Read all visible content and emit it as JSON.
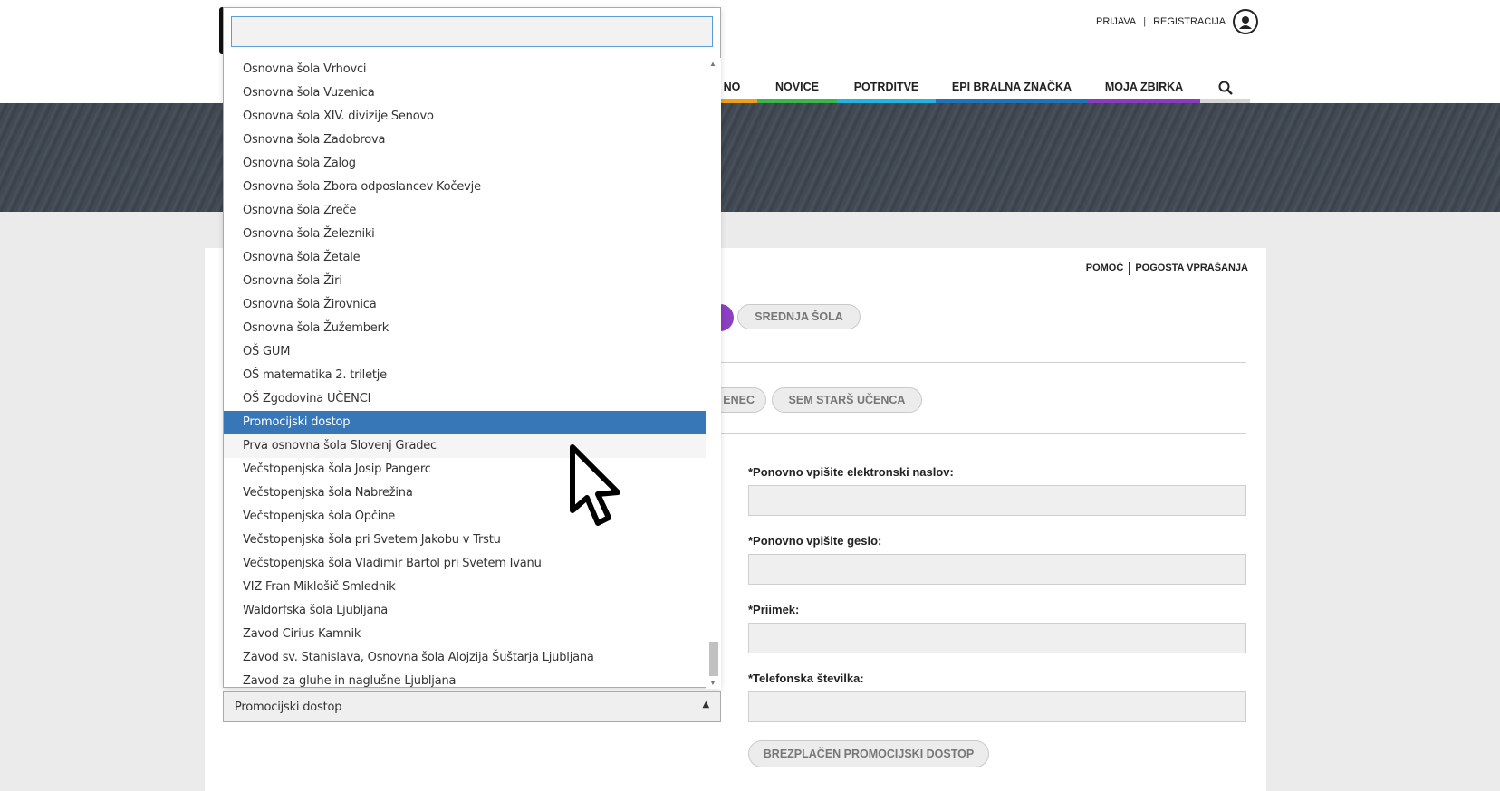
{
  "header": {
    "login_label": "PRIJAVA",
    "separator": "|",
    "register_label": "REGISTRACIJA",
    "user_icon": "user-silhouette-icon"
  },
  "nav": {
    "items": [
      {
        "label": "NO",
        "color": "#f0a018"
      },
      {
        "label": "NOVICE",
        "color": "#3cb64a"
      },
      {
        "label": "POTRDITVE",
        "color": "#1fb3e6"
      },
      {
        "label": "EPI BRALNA ZNAČKA",
        "color": "#1e73be"
      },
      {
        "label": "MOJA ZBIRKA",
        "color": "#8a3ac0"
      }
    ],
    "search_icon": "search-icon",
    "search_color": "#d6d6d6"
  },
  "help_bar": {
    "help_label": "POMOČ",
    "faq_label": "POGOSTA VPRAŠANJA"
  },
  "school_type": {
    "secondary_label": "SREDNJA ŠOLA"
  },
  "role": {
    "student_partial_label": "ENEC",
    "parent_label": "SEM STARŠ UČENCA"
  },
  "form": {
    "email_repeat_label": "*Ponovno vpišite elektronski naslov:",
    "password_repeat_label": "*Ponovno vpišite geslo:",
    "surname_label": "*Priimek:",
    "phone_label": "*Telefonska številka:",
    "submit_label": "BREZPLAČEN PROMOCIJSKI DOSTOP"
  },
  "school_select": {
    "search_value": "",
    "selected_value": "Promocijski dostop",
    "options": [
      "Osnovna šola Vrhovci",
      "Osnovna šola Vuzenica",
      "Osnovna šola XIV. divizije Senovo",
      "Osnovna šola Zadobrova",
      "Osnovna šola Zalog",
      "Osnovna šola Zbora odposlancev Kočevje",
      "Osnovna šola Zreče",
      "Osnovna šola Železniki",
      "Osnovna šola Žetale",
      "Osnovna šola Žiri",
      "Osnovna šola Žirovnica",
      "Osnovna šola Žužemberk",
      "OŠ GUM",
      "OŠ matematika 2. triletje",
      "OŠ Zgodovina UČENCI",
      "Promocijski dostop",
      "Prva osnovna šola Slovenj Gradec",
      "Večstopenjska šola Josip Pangerc",
      "Večstopenjska šola Nabrežina",
      "Večstopenjska šola Opčine",
      "Večstopenjska šola pri Svetem Jakobu v Trstu",
      "Večstopenjska šola Vladimir Bartol pri Svetem Ivanu",
      "VIZ Fran Miklošič Smlednik",
      "Waldorfska šola Ljubljana",
      "Zavod Cirius Kamnik",
      "Zavod sv. Stanislava, Osnovna šola Alojzija Šuštarja Ljubljana",
      "Zavod za gluhe in naglušne Ljubljana"
    ],
    "selected_index": 15,
    "hover_index": 16
  }
}
